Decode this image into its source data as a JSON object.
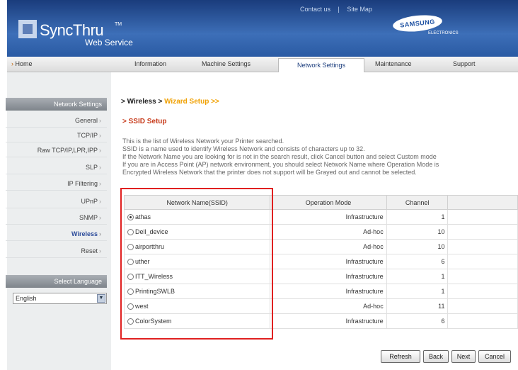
{
  "header": {
    "logo_main": "SyncThru",
    "logo_sup": "TM",
    "logo_sub": "Web Service",
    "top_links": [
      "Contact us",
      "|",
      "Site Map"
    ],
    "brand": "SAMSUNG",
    "brand_sub": "ELECTRONICS"
  },
  "nav": {
    "home": "Home",
    "items": [
      "Information",
      "Machine Settings",
      "Network Settings",
      "Maintenance",
      "Support"
    ],
    "active": "Network Settings"
  },
  "sidebar": {
    "section_title": "Network Settings",
    "items": [
      "General",
      "TCP/IP",
      "Raw TCP/IP,LPR,IPP",
      "SLP",
      "IP Filtering",
      "UPnP",
      "SNMP",
      "Wireless",
      "Reset"
    ],
    "active": "Wireless",
    "language_title": "Select Language",
    "language_value": "English"
  },
  "main": {
    "breadcrumb_main": "> Wireless >",
    "breadcrumb_sub": "Wizard Setup >>",
    "section_title": "> SSID Setup",
    "description": [
      "This is the list of Wireless Network your Printer searched.",
      "SSID is a name used to identify Wireless Network and consists of characters up to 32.",
      "If the Network Name you are looking for is not in the search result, click Cancel button and select Custom mode",
      "If you are in Access Point (AP) network environment, you should select Network Name where Operation Mode is",
      "Encrypted Wireless Network that the printer does not support will be Grayed out and cannot be selected."
    ],
    "table": {
      "headers": [
        "Network Name(SSID)",
        "Operation Mode",
        "Channel"
      ],
      "rows": [
        {
          "name": "athas",
          "mode": "Infrastructure",
          "channel": "1",
          "selected": true
        },
        {
          "name": "Dell_device",
          "mode": "Ad-hoc",
          "channel": "10",
          "selected": false
        },
        {
          "name": "airportthru",
          "mode": "Ad-hoc",
          "channel": "10",
          "selected": false
        },
        {
          "name": "uther",
          "mode": "Infrastructure",
          "channel": "6",
          "selected": false
        },
        {
          "name": "ITT_Wireless",
          "mode": "Infrastructure",
          "channel": "1",
          "selected": false
        },
        {
          "name": "PrintingSWLB",
          "mode": "Infrastructure",
          "channel": "1",
          "selected": false
        },
        {
          "name": "west",
          "mode": "Ad-hoc",
          "channel": "11",
          "selected": false
        },
        {
          "name": "ColorSystem",
          "mode": "Infrastructure",
          "channel": "6",
          "selected": false
        }
      ]
    },
    "buttons": [
      "Refresh",
      "Back",
      "Next",
      "Cancel"
    ]
  },
  "colors": {
    "header_blue": "#2a5aa3",
    "accent_orange": "#f0a000",
    "title_red": "#c73a1a",
    "highlight_red": "#e02020"
  }
}
